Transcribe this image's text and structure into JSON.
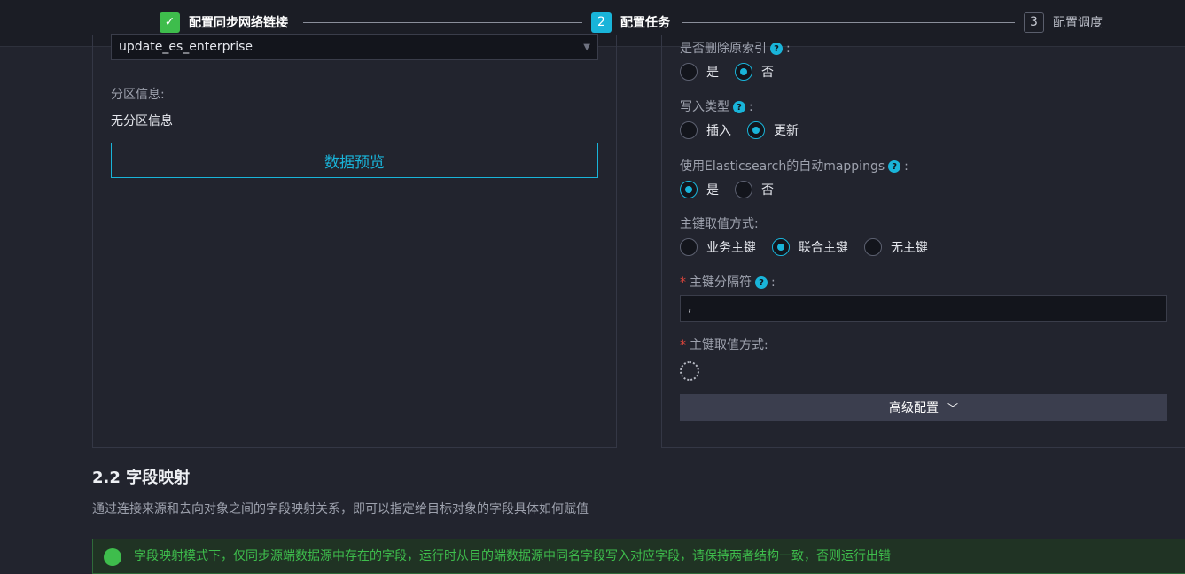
{
  "steps": [
    {
      "num": "✓",
      "label": "配置同步网络链接"
    },
    {
      "num": "2",
      "label": "配置任务"
    },
    {
      "num": "3",
      "label": "配置调度"
    }
  ],
  "left": {
    "select_value": "update_es_enterprise",
    "partition_label": "分区信息:",
    "partition_value": "无分区信息",
    "preview_button": "数据预览"
  },
  "right": {
    "delete_index_label": "是否删除原索引",
    "delete_index_options": [
      "是",
      "否"
    ],
    "delete_index_selected": "否",
    "write_type_label": "写入类型",
    "write_type_options": [
      "插入",
      "更新"
    ],
    "write_type_selected": "更新",
    "auto_mapping_label": "使用Elasticsearch的自动mappings",
    "auto_mapping_options": [
      "是",
      "否"
    ],
    "auto_mapping_selected": "是",
    "pk_mode_label": "主键取值方式:",
    "pk_mode_options": [
      "业务主键",
      "联合主键",
      "无主键"
    ],
    "pk_mode_selected": "联合主键",
    "pk_separator_label": "主键分隔符",
    "pk_separator_value": ",",
    "pk_value_label": "主键取值方式:",
    "advanced_button": "高级配置"
  },
  "section": {
    "title": "2.2 字段映射",
    "description": "通过连接来源和去向对象之间的字段映射关系，即可以指定给目标对象的字段具体如何赋值",
    "notice": "字段映射模式下，仅同步源端数据源中存在的字段，运行时从目的端数据源中同名字段写入对应字段，请保持两者结构一致，否则运行出错"
  },
  "colors": {
    "accent": "#19b4d9",
    "success": "#3ebd4c",
    "required": "#e0463b"
  }
}
